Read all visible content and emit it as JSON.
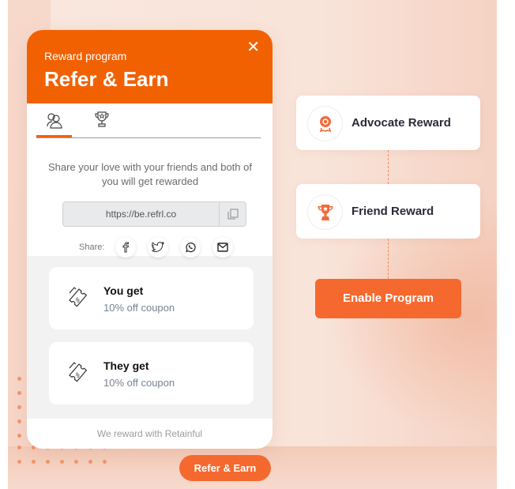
{
  "widget": {
    "subtitle": "Reward program",
    "title": "Refer & Earn",
    "close_icon": "close-icon",
    "tabs": [
      {
        "icon": "users-icon",
        "active": true
      },
      {
        "icon": "trophy-icon",
        "active": false
      }
    ],
    "description": "Share your love with your friends and both of you will get rewarded",
    "referral_link": "https://be.refrl.co",
    "copy_icon": "copy-icon",
    "share_label": "Share:",
    "share_icons": [
      "facebook-icon",
      "twitter-icon",
      "whatsapp-icon",
      "email-icon"
    ],
    "cards": [
      {
        "title": "You get",
        "subtitle": "10% off coupon",
        "icon": "coupon-icon"
      },
      {
        "title": "They get",
        "subtitle": "10% off coupon",
        "icon": "coupon-icon"
      }
    ],
    "footer": "We reward with Retainful"
  },
  "launcher_button": "Refer & Earn",
  "flow": {
    "steps": [
      {
        "label": "Advocate Reward",
        "icon": "badge-icon"
      },
      {
        "label": "Friend Reward",
        "icon": "trophy-icon"
      }
    ],
    "action_button": "Enable Program"
  },
  "colors": {
    "brand_orange": "#f26101",
    "button_orange": "#f5692f"
  }
}
